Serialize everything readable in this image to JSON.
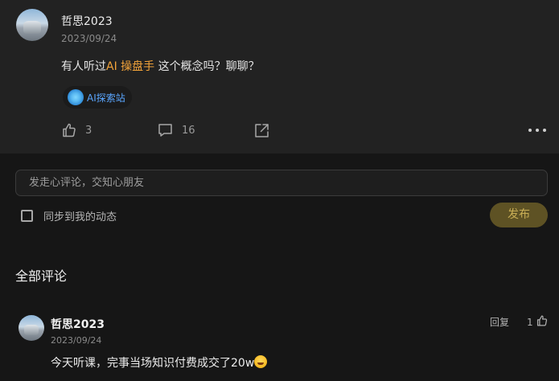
{
  "post": {
    "author": "哲思2023",
    "date": "2023/09/24",
    "content_before": "有人听过",
    "content_highlight": "AI 操盘手",
    "content_after": " 这个概念吗？聊聊？",
    "tag_label": "AI探索站",
    "like_count": "3",
    "comment_count": "16",
    "icons": [
      "thumbs-up-icon",
      "comment-icon",
      "share-icon",
      "more-icon"
    ]
  },
  "composer": {
    "placeholder": "发走心评论，交知心朋友",
    "sync_label": "同步到我的动态",
    "publish_label": "发布"
  },
  "comments_section": {
    "title": "全部评论",
    "items": [
      {
        "author": "哲思2023",
        "date": "2023/09/24",
        "text": "今天听课，完事当场知识付费成交了20w",
        "reply_label": "回复",
        "like_count": "1"
      }
    ]
  },
  "colors": {
    "background": "#161616",
    "post_background": "#222222",
    "highlight": "#f2a33a",
    "tag_text": "#5aa6ff",
    "publish_bg": "#5e5224",
    "publish_text": "#c9ae55"
  }
}
